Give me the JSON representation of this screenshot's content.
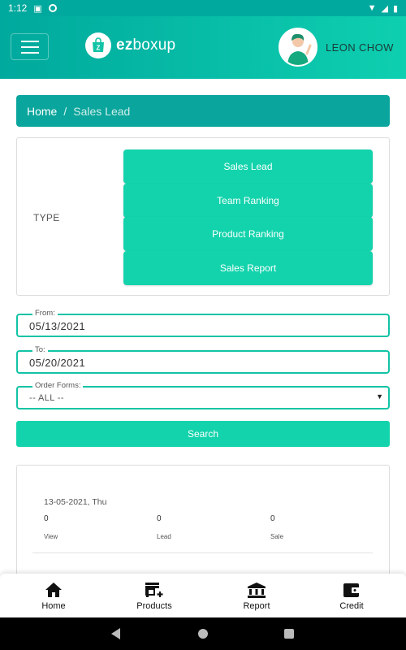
{
  "status_bar": {
    "time": "1:12"
  },
  "header": {
    "logo_mark": "ez",
    "logo_bold": "ez",
    "logo_rest": "boxup",
    "user_name": "LEON CHOW"
  },
  "breadcrumb": {
    "home": "Home",
    "separator": "/",
    "current": "Sales Lead"
  },
  "type_card": {
    "label": "TYPE",
    "options": [
      "Sales Lead",
      "Team Ranking",
      "Product Ranking",
      "Sales Report"
    ]
  },
  "filters": {
    "from_label": "From:",
    "from_value": "05/13/2021",
    "to_label": "To:",
    "to_value": "05/20/2021",
    "order_forms_label": "Order Forms:",
    "order_forms_value": "-- ALL --"
  },
  "search_button": "Search",
  "results": {
    "date": "13-05-2021, Thu",
    "stats": [
      {
        "value": "0",
        "label": "View"
      },
      {
        "value": "0",
        "label": "Lead"
      },
      {
        "value": "0",
        "label": "Sale"
      }
    ]
  },
  "bottom_nav": [
    {
      "label": "Home",
      "icon": "home-icon"
    },
    {
      "label": "Products",
      "icon": "store-add-icon"
    },
    {
      "label": "Report",
      "icon": "bank-icon"
    },
    {
      "label": "Credit",
      "icon": "wallet-icon"
    }
  ],
  "colors": {
    "primary": "#13d3ac",
    "header_start": "#00a99d",
    "breadcrumb": "#0aa59c"
  }
}
